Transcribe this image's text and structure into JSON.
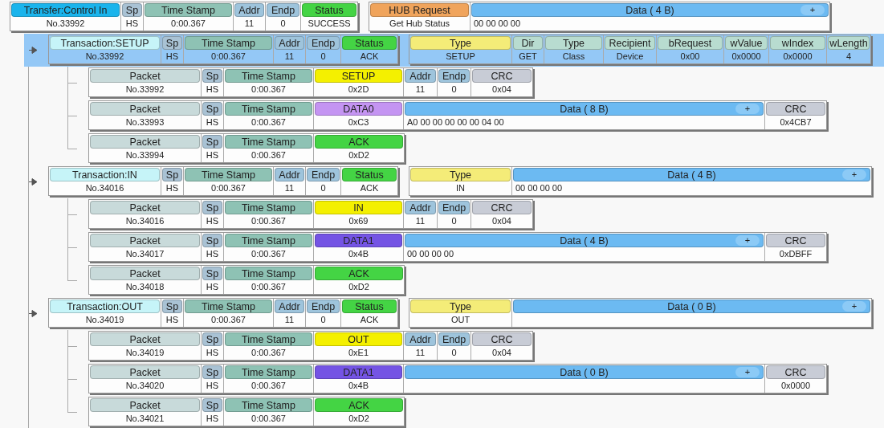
{
  "transfer": {
    "kind": "transfer",
    "selected": false,
    "groups": [
      {
        "fields": [
          {
            "kind": "name",
            "label": "Transfer:Control In",
            "value": "No.33992",
            "color": "#1ab4ec"
          },
          {
            "kind": "sp",
            "label": "Sp",
            "value": "HS",
            "color": "#a9c2d4"
          },
          {
            "kind": "time",
            "label": "Time Stamp",
            "value": "0:00.367",
            "color": "#8ec2b4"
          },
          {
            "kind": "addr",
            "label": "Addr",
            "value": "11",
            "color": "#9ec4dc"
          },
          {
            "kind": "endp",
            "label": "Endp",
            "value": "0",
            "color": "#9ec4dc"
          },
          {
            "kind": "status",
            "label": "Status",
            "value": "SUCCESS",
            "color": "#44d444"
          }
        ]
      },
      {
        "fields": [
          {
            "kind": "request",
            "label": "HUB Request",
            "value": "Get Hub Status",
            "color": "#f0a45c"
          },
          {
            "kind": "data",
            "label": "Data ( 4 B)",
            "value": "00 00 00 00",
            "button": "+",
            "color": "#6cbaf2"
          }
        ]
      }
    ],
    "children": [
      {
        "kind": "transaction",
        "selected": true,
        "groups": [
          {
            "fields": [
              {
                "kind": "name",
                "label": "Transaction:SETUP",
                "value": "No.33992",
                "color": "#c6f4f8"
              },
              {
                "kind": "sp",
                "label": "Sp",
                "value": "HS",
                "color": "#a9c2d4"
              },
              {
                "kind": "time",
                "label": "Time Stamp",
                "value": "0:00.367",
                "color": "#8ec2b4"
              },
              {
                "kind": "addr",
                "label": "Addr",
                "value": "11",
                "color": "#9ec4dc"
              },
              {
                "kind": "endp",
                "label": "Endp",
                "value": "0",
                "color": "#9ec4dc"
              },
              {
                "kind": "status",
                "label": "Status",
                "value": "ACK",
                "color": "#44d444"
              }
            ]
          },
          {
            "fields": [
              {
                "kind": "type",
                "label": "Type",
                "value": "SETUP",
                "color": "#f4ec78"
              },
              {
                "kind": "dir",
                "label": "Dir",
                "value": "GET",
                "color": "#b8dcd0"
              },
              {
                "kind": "reqtype",
                "label": "Type",
                "value": "Class",
                "color": "#b8dcd0"
              },
              {
                "kind": "recipient",
                "label": "Recipient",
                "value": "Device",
                "color": "#b8dcd0"
              },
              {
                "kind": "brequest",
                "label": "bRequest",
                "value": "0x00",
                "color": "#b8dcd0"
              },
              {
                "kind": "wvalue",
                "label": "wValue",
                "value": "0x0000",
                "color": "#b8dcd0"
              },
              {
                "kind": "windex",
                "label": "wIndex",
                "value": "0x0000",
                "color": "#b8dcd0"
              },
              {
                "kind": "wlength",
                "label": "wLength",
                "value": "4",
                "color": "#b8dcd0"
              }
            ]
          }
        ],
        "children": [
          {
            "kind": "packet",
            "selected": false,
            "groups": [
              {
                "fields": [
                  {
                    "kind": "name",
                    "label": "Packet",
                    "value": "No.33992",
                    "color": "#c8dada"
                  },
                  {
                    "kind": "sp",
                    "label": "Sp",
                    "value": "HS",
                    "color": "#a9c2d4"
                  },
                  {
                    "kind": "time",
                    "label": "Time Stamp",
                    "value": "0:00.367",
                    "color": "#8ec2b4"
                  },
                  {
                    "kind": "pid",
                    "label": "SETUP",
                    "value": "0x2D",
                    "color": "#f4f000"
                  },
                  {
                    "kind": "addr",
                    "label": "Addr",
                    "value": "11",
                    "color": "#9ec4dc"
                  },
                  {
                    "kind": "endp",
                    "label": "Endp",
                    "value": "0",
                    "color": "#9ec4dc"
                  },
                  {
                    "kind": "crc",
                    "label": "CRC",
                    "value": "0x04",
                    "color": "#c8ccd6"
                  }
                ]
              }
            ]
          },
          {
            "kind": "packet",
            "selected": false,
            "groups": [
              {
                "fields": [
                  {
                    "kind": "name",
                    "label": "Packet",
                    "value": "No.33993",
                    "color": "#c8dada"
                  },
                  {
                    "kind": "sp",
                    "label": "Sp",
                    "value": "HS",
                    "color": "#a9c2d4"
                  },
                  {
                    "kind": "time",
                    "label": "Time Stamp",
                    "value": "0:00.367",
                    "color": "#8ec2b4"
                  },
                  {
                    "kind": "pid",
                    "label": "DATA0",
                    "value": "0xC3",
                    "color": "#c494f2"
                  },
                  {
                    "kind": "data",
                    "label": "Data ( 8 B)",
                    "value": "A0 00 00 00 00 00 04 00",
                    "button": "+",
                    "color": "#6cbaf2"
                  },
                  {
                    "kind": "crc",
                    "label": "CRC",
                    "value": "0x4CB7",
                    "color": "#c8ccd6"
                  }
                ]
              }
            ]
          },
          {
            "kind": "packet",
            "selected": false,
            "groups": [
              {
                "fields": [
                  {
                    "kind": "name",
                    "label": "Packet",
                    "value": "No.33994",
                    "color": "#c8dada"
                  },
                  {
                    "kind": "sp",
                    "label": "Sp",
                    "value": "HS",
                    "color": "#a9c2d4"
                  },
                  {
                    "kind": "time",
                    "label": "Time Stamp",
                    "value": "0:00.367",
                    "color": "#8ec2b4"
                  },
                  {
                    "kind": "pid",
                    "label": "ACK",
                    "value": "0xD2",
                    "color": "#44d444"
                  }
                ]
              }
            ]
          }
        ]
      },
      {
        "kind": "transaction",
        "selected": false,
        "groups": [
          {
            "fields": [
              {
                "kind": "name",
                "label": "Transaction:IN",
                "value": "No.34016",
                "color": "#c6f4f8"
              },
              {
                "kind": "sp",
                "label": "Sp",
                "value": "HS",
                "color": "#a9c2d4"
              },
              {
                "kind": "time",
                "label": "Time Stamp",
                "value": "0:00.367",
                "color": "#8ec2b4"
              },
              {
                "kind": "addr",
                "label": "Addr",
                "value": "11",
                "color": "#9ec4dc"
              },
              {
                "kind": "endp",
                "label": "Endp",
                "value": "0",
                "color": "#9ec4dc"
              },
              {
                "kind": "status",
                "label": "Status",
                "value": "ACK",
                "color": "#44d444"
              }
            ]
          },
          {
            "fields": [
              {
                "kind": "type",
                "label": "Type",
                "value": "IN",
                "color": "#f4ec78"
              },
              {
                "kind": "data",
                "label": "Data ( 4 B)",
                "value": "00 00 00 00",
                "button": "+",
                "color": "#6cbaf2"
              }
            ]
          }
        ],
        "children": [
          {
            "kind": "packet",
            "selected": false,
            "groups": [
              {
                "fields": [
                  {
                    "kind": "name",
                    "label": "Packet",
                    "value": "No.34016",
                    "color": "#c8dada"
                  },
                  {
                    "kind": "sp",
                    "label": "Sp",
                    "value": "HS",
                    "color": "#a9c2d4"
                  },
                  {
                    "kind": "time",
                    "label": "Time Stamp",
                    "value": "0:00.367",
                    "color": "#8ec2b4"
                  },
                  {
                    "kind": "pid",
                    "label": "IN",
                    "value": "0x69",
                    "color": "#f4f000"
                  },
                  {
                    "kind": "addr",
                    "label": "Addr",
                    "value": "11",
                    "color": "#9ec4dc"
                  },
                  {
                    "kind": "endp",
                    "label": "Endp",
                    "value": "0",
                    "color": "#9ec4dc"
                  },
                  {
                    "kind": "crc",
                    "label": "CRC",
                    "value": "0x04",
                    "color": "#c8ccd6"
                  }
                ]
              }
            ]
          },
          {
            "kind": "packet",
            "selected": false,
            "groups": [
              {
                "fields": [
                  {
                    "kind": "name",
                    "label": "Packet",
                    "value": "No.34017",
                    "color": "#c8dada"
                  },
                  {
                    "kind": "sp",
                    "label": "Sp",
                    "value": "HS",
                    "color": "#a9c2d4"
                  },
                  {
                    "kind": "time",
                    "label": "Time Stamp",
                    "value": "0:00.367",
                    "color": "#8ec2b4"
                  },
                  {
                    "kind": "pid",
                    "label": "DATA1",
                    "value": "0x4B",
                    "color": "#7454e4"
                  },
                  {
                    "kind": "data",
                    "label": "Data ( 4 B)",
                    "value": "00 00 00 00",
                    "button": "+",
                    "color": "#6cbaf2"
                  },
                  {
                    "kind": "crc",
                    "label": "CRC",
                    "value": "0xDBFF",
                    "color": "#c8ccd6"
                  }
                ]
              }
            ]
          },
          {
            "kind": "packet",
            "selected": false,
            "groups": [
              {
                "fields": [
                  {
                    "kind": "name",
                    "label": "Packet",
                    "value": "No.34018",
                    "color": "#c8dada"
                  },
                  {
                    "kind": "sp",
                    "label": "Sp",
                    "value": "HS",
                    "color": "#a9c2d4"
                  },
                  {
                    "kind": "time",
                    "label": "Time Stamp",
                    "value": "0:00.367",
                    "color": "#8ec2b4"
                  },
                  {
                    "kind": "pid",
                    "label": "ACK",
                    "value": "0xD2",
                    "color": "#44d444"
                  }
                ]
              }
            ]
          }
        ]
      },
      {
        "kind": "transaction",
        "selected": false,
        "groups": [
          {
            "fields": [
              {
                "kind": "name",
                "label": "Transaction:OUT",
                "value": "No.34019",
                "color": "#c6f4f8"
              },
              {
                "kind": "sp",
                "label": "Sp",
                "value": "HS",
                "color": "#a9c2d4"
              },
              {
                "kind": "time",
                "label": "Time Stamp",
                "value": "0:00.367",
                "color": "#8ec2b4"
              },
              {
                "kind": "addr",
                "label": "Addr",
                "value": "11",
                "color": "#9ec4dc"
              },
              {
                "kind": "endp",
                "label": "Endp",
                "value": "0",
                "color": "#9ec4dc"
              },
              {
                "kind": "status",
                "label": "Status",
                "value": "ACK",
                "color": "#44d444"
              }
            ]
          },
          {
            "fields": [
              {
                "kind": "type",
                "label": "Type",
                "value": "OUT",
                "color": "#f4ec78"
              },
              {
                "kind": "data",
                "label": "Data ( 0 B)",
                "button": "+",
                "color": "#6cbaf2"
              }
            ]
          }
        ],
        "children": [
          {
            "kind": "packet",
            "selected": false,
            "groups": [
              {
                "fields": [
                  {
                    "kind": "name",
                    "label": "Packet",
                    "value": "No.34019",
                    "color": "#c8dada"
                  },
                  {
                    "kind": "sp",
                    "label": "Sp",
                    "value": "HS",
                    "color": "#a9c2d4"
                  },
                  {
                    "kind": "time",
                    "label": "Time Stamp",
                    "value": "0:00.367",
                    "color": "#8ec2b4"
                  },
                  {
                    "kind": "pid",
                    "label": "OUT",
                    "value": "0xE1",
                    "color": "#f4f000"
                  },
                  {
                    "kind": "addr",
                    "label": "Addr",
                    "value": "11",
                    "color": "#9ec4dc"
                  },
                  {
                    "kind": "endp",
                    "label": "Endp",
                    "value": "0",
                    "color": "#9ec4dc"
                  },
                  {
                    "kind": "crc",
                    "label": "CRC",
                    "value": "0x04",
                    "color": "#c8ccd6"
                  }
                ]
              }
            ]
          },
          {
            "kind": "packet",
            "selected": false,
            "groups": [
              {
                "fields": [
                  {
                    "kind": "name",
                    "label": "Packet",
                    "value": "No.34020",
                    "color": "#c8dada"
                  },
                  {
                    "kind": "sp",
                    "label": "Sp",
                    "value": "HS",
                    "color": "#a9c2d4"
                  },
                  {
                    "kind": "time",
                    "label": "Time Stamp",
                    "value": "0:00.367",
                    "color": "#8ec2b4"
                  },
                  {
                    "kind": "pid",
                    "label": "DATA1",
                    "value": "0x4B",
                    "color": "#7454e4"
                  },
                  {
                    "kind": "data",
                    "label": "Data ( 0 B)",
                    "button": "+",
                    "color": "#6cbaf2"
                  },
                  {
                    "kind": "crc",
                    "label": "CRC",
                    "value": "0x0000",
                    "color": "#c8ccd6"
                  }
                ]
              }
            ]
          },
          {
            "kind": "packet",
            "selected": false,
            "groups": [
              {
                "fields": [
                  {
                    "kind": "name",
                    "label": "Packet",
                    "value": "No.34021",
                    "color": "#c8dada"
                  },
                  {
                    "kind": "sp",
                    "label": "Sp",
                    "value": "HS",
                    "color": "#a9c2d4"
                  },
                  {
                    "kind": "time",
                    "label": "Time Stamp",
                    "value": "0:00.367",
                    "color": "#8ec2b4"
                  },
                  {
                    "kind": "pid",
                    "label": "ACK",
                    "value": "0xD2",
                    "color": "#44d444"
                  }
                ]
              }
            ]
          }
        ]
      }
    ]
  }
}
